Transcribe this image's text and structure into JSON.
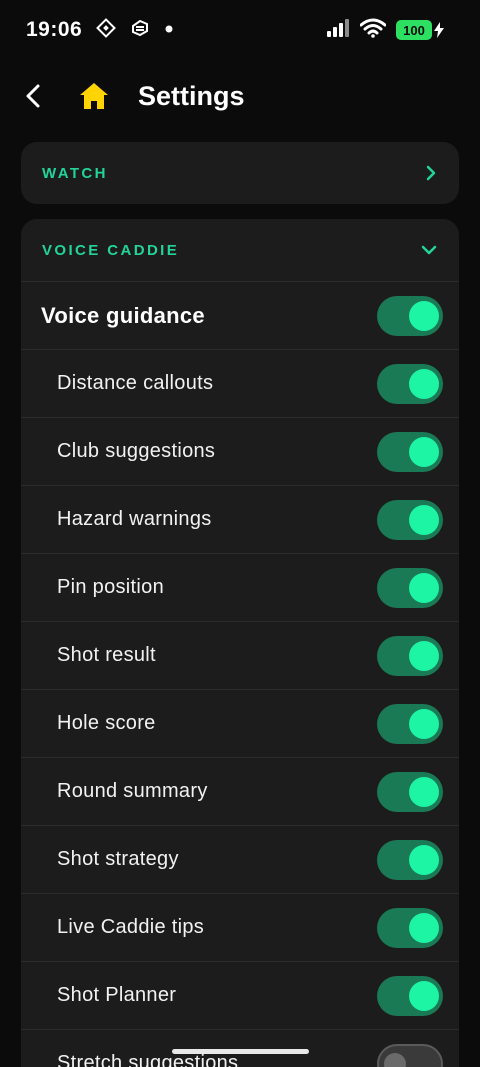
{
  "status_bar": {
    "time": "19:06",
    "battery": "100",
    "icons": [
      "notification-icon-1",
      "notification-icon-2",
      "dot-icon",
      "signal-icon",
      "wifi-icon",
      "battery-icon",
      "charging-icon"
    ]
  },
  "header": {
    "title": "Settings",
    "back_icon": "chevron-left-icon",
    "home_icon": "home-icon"
  },
  "sections": {
    "watch": {
      "title": "WATCH",
      "icon": "chevron-right-icon"
    },
    "voice_caddie": {
      "title": "VOICE CADDIE",
      "icon": "chevron-down-icon",
      "main_toggle": {
        "label": "Voice guidance",
        "on": true
      },
      "items": [
        {
          "label": "Distance callouts",
          "on": true
        },
        {
          "label": "Club suggestions",
          "on": true
        },
        {
          "label": "Hazard warnings",
          "on": true
        },
        {
          "label": "Pin position",
          "on": true
        },
        {
          "label": "Shot result",
          "on": true
        },
        {
          "label": "Hole score",
          "on": true
        },
        {
          "label": "Round summary",
          "on": true
        },
        {
          "label": "Shot strategy",
          "on": true
        },
        {
          "label": "Live Caddie tips",
          "on": true
        },
        {
          "label": "Shot Planner",
          "on": true
        },
        {
          "label": "Stretch suggestions",
          "on": false
        }
      ]
    }
  },
  "colors": {
    "accent": "#22d49a",
    "toggle_track_on": "#1a7a55",
    "toggle_knob_on": "#1df5a4",
    "home_icon": "#ffd400",
    "card_bg": "#1c1c1c",
    "screen_bg": "#0b0b0b"
  }
}
